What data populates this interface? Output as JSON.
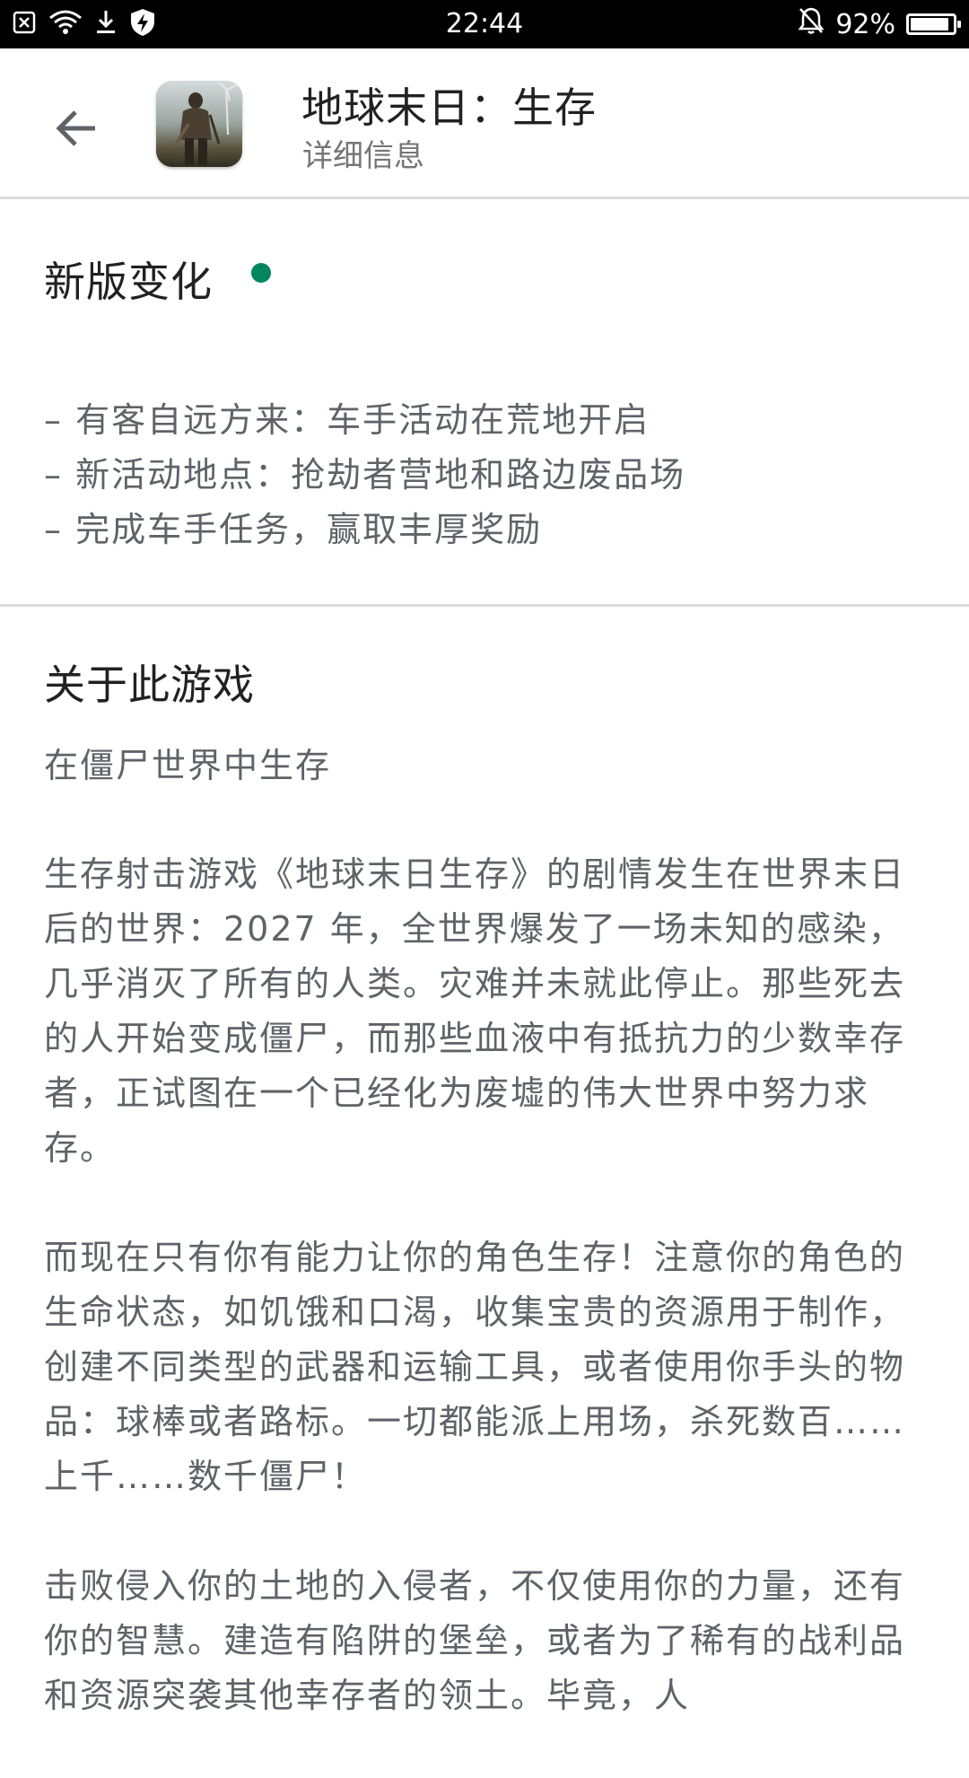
{
  "status_bar": {
    "time": "22:44",
    "battery_percent": "92%",
    "battery_level": 0.92,
    "icons": [
      "notification-x-icon",
      "wifi-icon",
      "download-icon",
      "shield-bolt-icon",
      "bell-off-icon",
      "battery-icon"
    ]
  },
  "header": {
    "title": "地球末日：生存",
    "subtitle": "详细信息",
    "back_icon": "arrow-back-icon",
    "app_icon": "game-app-icon"
  },
  "whats_new": {
    "title": "新版变化",
    "dot_color": "#01875f",
    "items": [
      "– 有客自远方来：车手活动在荒地开启",
      "– 新活动地点：抢劫者营地和路边废品场",
      "– 完成车手任务，赢取丰厚奖励"
    ]
  },
  "about": {
    "title": "关于此游戏",
    "tagline": "在僵尸世界中生存",
    "paragraphs": [
      "生存射击游戏《地球末日生存》的剧情发生在世界末日后的世界：2027 年，全世界爆发了一场未知的感染，几乎消灭了所有的人类。灾难并未就此停止。那些死去的人开始变成僵尸，而那些血液中有抵抗力的少数幸存者，正试图在一个已经化为废墟的伟大世界中努力求存。",
      "而现在只有你有能力让你的角色生存！注意你的角色的生命状态，如饥饿和口渴，收集宝贵的资源用于制作，创建不同类型的武器和运输工具，或者使用你手头的物品：球棒或者路标。一切都能派上用场，杀死数百……上千……数千僵尸！",
      "击败侵入你的土地的入侵者，不仅使用你的力量，还有你的智慧。建造有陷阱的堡垒，或者为了稀有的战利品和资源突袭其他幸存者的领土。毕竟，人"
    ]
  },
  "colors": {
    "status_bar_bg": "#000000",
    "title_text": "#212121",
    "body_text": "#5f6368",
    "divider": "#dcdcdc",
    "accent_green": "#01875f"
  }
}
